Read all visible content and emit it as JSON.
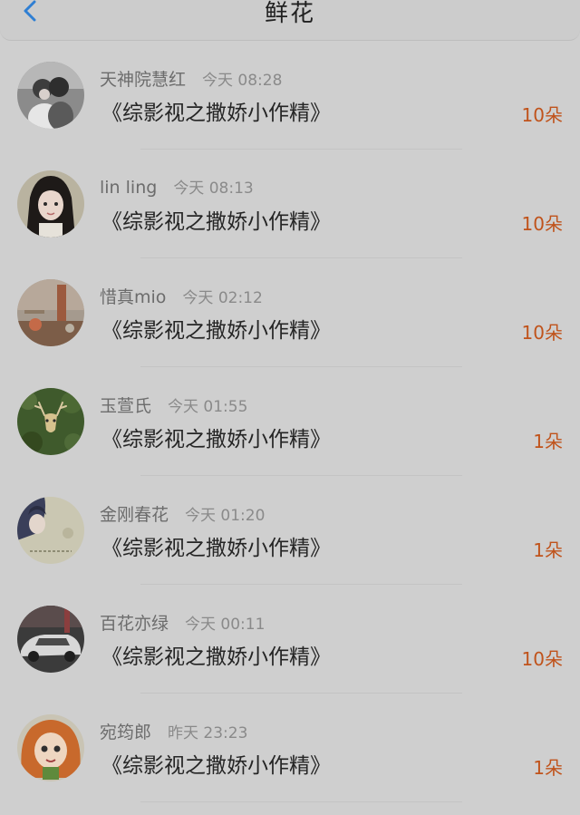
{
  "header": {
    "title": "鲜花",
    "back_icon": "chevron-left-icon",
    "accent_color": "#2f7fd3"
  },
  "colors": {
    "count": "#c0531b",
    "background": "#cfcfcf"
  },
  "flowers": [
    {
      "name": "天神院慧红",
      "time": "今天 08:28",
      "book": "《综影视之撒娇小作精》",
      "count": "10朵"
    },
    {
      "name": "lin ling",
      "time": "今天 08:13",
      "book": "《综影视之撒娇小作精》",
      "count": "10朵"
    },
    {
      "name": "惜真mio",
      "time": "今天 02:12",
      "book": "《综影视之撒娇小作精》",
      "count": "10朵"
    },
    {
      "name": "玉萱氏",
      "time": "今天 01:55",
      "book": "《综影视之撒娇小作精》",
      "count": "1朵"
    },
    {
      "name": "金刚春花",
      "time": "今天 01:20",
      "book": "《综影视之撒娇小作精》",
      "count": "1朵"
    },
    {
      "name": "百花亦绿",
      "time": "今天 00:11",
      "book": "《综影视之撒娇小作精》",
      "count": "10朵"
    },
    {
      "name": "宛筠郎",
      "time": "昨天 23:23",
      "book": "《综影视之撒娇小作精》",
      "count": "1朵"
    }
  ]
}
